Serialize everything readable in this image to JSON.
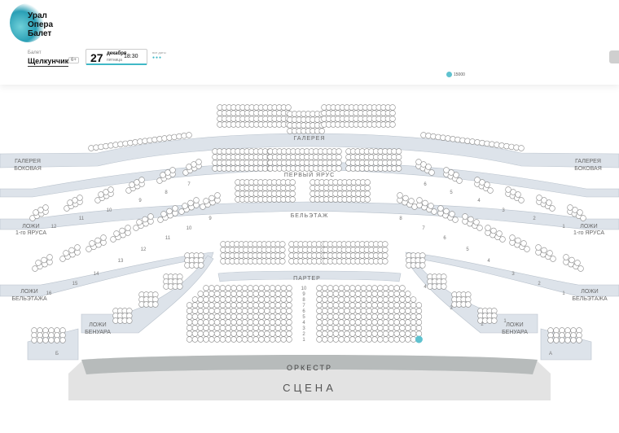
{
  "logo": {
    "lines": [
      "Урал",
      "Опера",
      "Балет"
    ]
  },
  "event": {
    "genre": "Балет",
    "title": "Щелкунчик",
    "age": "6+",
    "date": {
      "day": "27",
      "month": "декабря",
      "weekday": "пятница",
      "time": "18:30"
    },
    "all_dates_label": "все даты"
  },
  "legend": {
    "price": "15000",
    "color": "#5fc2cf"
  },
  "hall": {
    "sections": {
      "gallery": "ГАЛЕРЕЯ",
      "first_tier": "ПЕРВЫЙ ЯРУС",
      "beletage": "БЕЛЬЭТАЖ",
      "parterre": "ПАРТЕР",
      "orchestra": "ОРКЕСТР",
      "stage": "СЦЕНА"
    },
    "side_labels": {
      "gallery_side_left": [
        "ГАЛЕРЕЯ",
        "БОКОВАЯ"
      ],
      "gallery_side_right": [
        "ГАЛЕРЕЯ",
        "БОКОВАЯ"
      ],
      "boxes_tier1_left": [
        "ЛОЖИ",
        "1-го ЯРУСА"
      ],
      "boxes_tier1_right": [
        "ЛОЖИ",
        "1-го ЯРУСА"
      ],
      "boxes_bel_left": [
        "ЛОЖИ",
        "БЕЛЬЭТАЖА"
      ],
      "boxes_bel_right": [
        "ЛОЖИ",
        "БЕЛЬЭТАЖА"
      ],
      "benoir_left": [
        "ЛОЖИ",
        "БЕНУАРА"
      ],
      "benoir_right": [
        "ЛОЖИ",
        "БЕНУАРА"
      ]
    },
    "parterre_rows": [
      "10",
      "9",
      "8",
      "7",
      "6",
      "5",
      "4",
      "3",
      "2",
      "1"
    ],
    "box_numbers": {
      "first_tier_left": [
        "12",
        "11",
        "10",
        "9",
        "8",
        "7"
      ],
      "first_tier_right": [
        "6",
        "5",
        "4",
        "3",
        "2",
        "1"
      ],
      "beletage_left": [
        "16",
        "15",
        "14",
        "13",
        "12",
        "11",
        "10",
        "9"
      ],
      "beletage_right": [
        "8",
        "7",
        "6",
        "5",
        "4",
        "3",
        "2",
        "1"
      ],
      "tier_upper_left": [
        "12",
        "11",
        "10",
        "9",
        "8",
        "7"
      ],
      "benoir_left": [
        "6",
        "7",
        "8",
        "9"
      ],
      "benoir_right": [
        "4",
        "3",
        "2",
        "1"
      ],
      "corner_left": "Б",
      "corner_right": "А"
    },
    "colors": {
      "seat": "#ffffff",
      "seat_stroke": "#8a8a8a",
      "band": "#dde3ea",
      "stage": "#e4e4e4",
      "orchestra": "#b9bdbd",
      "available": "#5fc2cf"
    }
  }
}
